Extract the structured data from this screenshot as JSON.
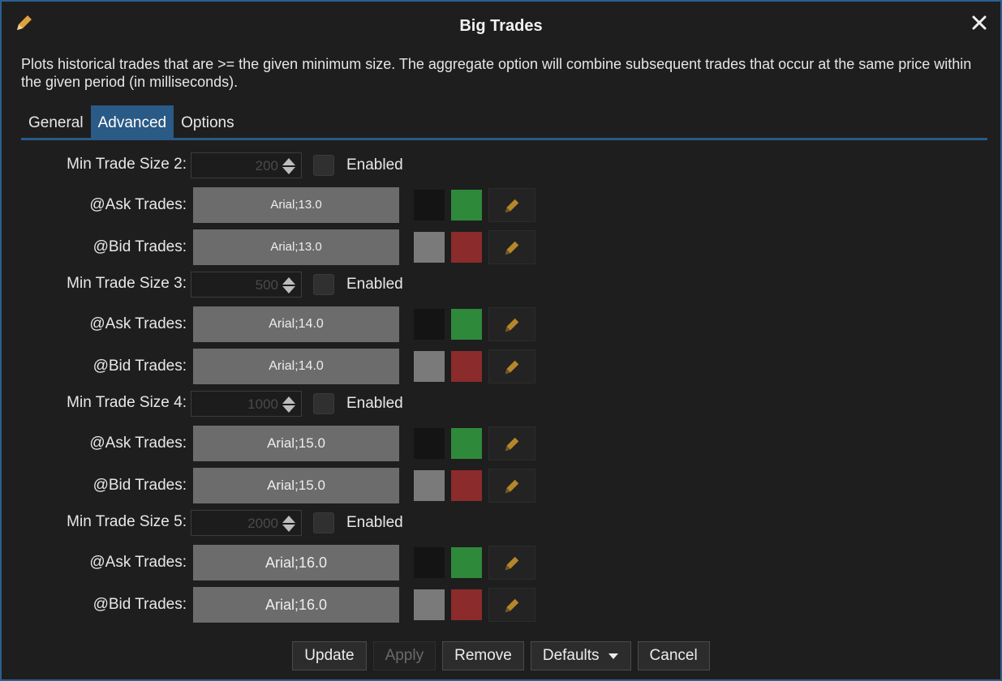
{
  "dialog": {
    "title": "Big Trades",
    "description": "Plots historical trades that are >= the given minimum size.  The aggregate option will combine subsequent trades that occur at the same price within the given period (in milliseconds)."
  },
  "tabs": [
    {
      "label": "General",
      "active": false
    },
    {
      "label": "Advanced",
      "active": true
    },
    {
      "label": "Options",
      "active": false
    }
  ],
  "groups": [
    {
      "label": "Min Trade Size 2:",
      "value": "200",
      "enabled_label": "Enabled",
      "enabled": false,
      "ask": {
        "label": "@Ask Trades:",
        "font": "Arial;13.0",
        "bg": "#141414",
        "fg": "#2e8a3a"
      },
      "bid": {
        "label": "@Bid Trades:",
        "font": "Arial;13.0",
        "bg": "#7a7a7a",
        "fg": "#8b2b2b"
      }
    },
    {
      "label": "Min Trade Size 3:",
      "value": "500",
      "enabled_label": "Enabled",
      "enabled": false,
      "ask": {
        "label": "@Ask Trades:",
        "font": "Arial;14.0",
        "bg": "#141414",
        "fg": "#2e8a3a"
      },
      "bid": {
        "label": "@Bid Trades:",
        "font": "Arial;14.0",
        "bg": "#7a7a7a",
        "fg": "#8b2b2b"
      }
    },
    {
      "label": "Min Trade Size 4:",
      "value": "1000",
      "enabled_label": "Enabled",
      "enabled": false,
      "ask": {
        "label": "@Ask Trades:",
        "font": "Arial;15.0",
        "bg": "#141414",
        "fg": "#2e8a3a"
      },
      "bid": {
        "label": "@Bid Trades:",
        "font": "Arial;15.0",
        "bg": "#7a7a7a",
        "fg": "#8b2b2b"
      }
    },
    {
      "label": "Min Trade Size 5:",
      "value": "2000",
      "enabled_label": "Enabled",
      "enabled": false,
      "ask": {
        "label": "@Ask Trades:",
        "font": "Arial;16.0",
        "bg": "#141414",
        "fg": "#2e8a3a"
      },
      "bid": {
        "label": "@Bid Trades:",
        "font": "Arial;16.0",
        "bg": "#7a7a7a",
        "fg": "#8b2b2b"
      }
    }
  ],
  "footer": {
    "update": "Update",
    "apply": "Apply",
    "remove": "Remove",
    "defaults": "Defaults",
    "cancel": "Cancel"
  },
  "colors": {
    "accent": "#2a5a86",
    "pencil": "#c8962e"
  },
  "icons": {
    "title": "pencil-icon",
    "close": "close-icon",
    "spinner": "up-down-arrows-icon",
    "edit": "pencil-icon",
    "dropdown": "caret-down-icon"
  }
}
